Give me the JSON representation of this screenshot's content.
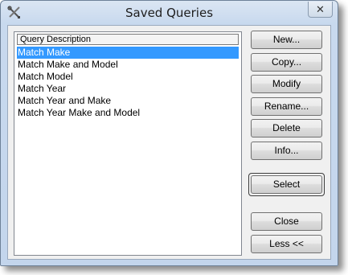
{
  "window": {
    "title": "Saved Queries"
  },
  "list": {
    "header": "Query Description",
    "items": [
      "Match Make",
      "Match Make and Model",
      "Match Model",
      "Match Year",
      "Match Year and Make",
      "Match Year Make and Model"
    ],
    "selected_index": 0
  },
  "buttons": {
    "new": "New...",
    "copy": "Copy...",
    "modify": "Modify",
    "rename": "Rename...",
    "delete": "Delete",
    "info": "Info...",
    "select": "Select",
    "close": "Close",
    "less": "Less <<"
  },
  "icons": {
    "app": "tools-icon",
    "close": "close-icon"
  },
  "colors": {
    "selection": "#3399ff",
    "title_bar": "#c8d9ee"
  }
}
